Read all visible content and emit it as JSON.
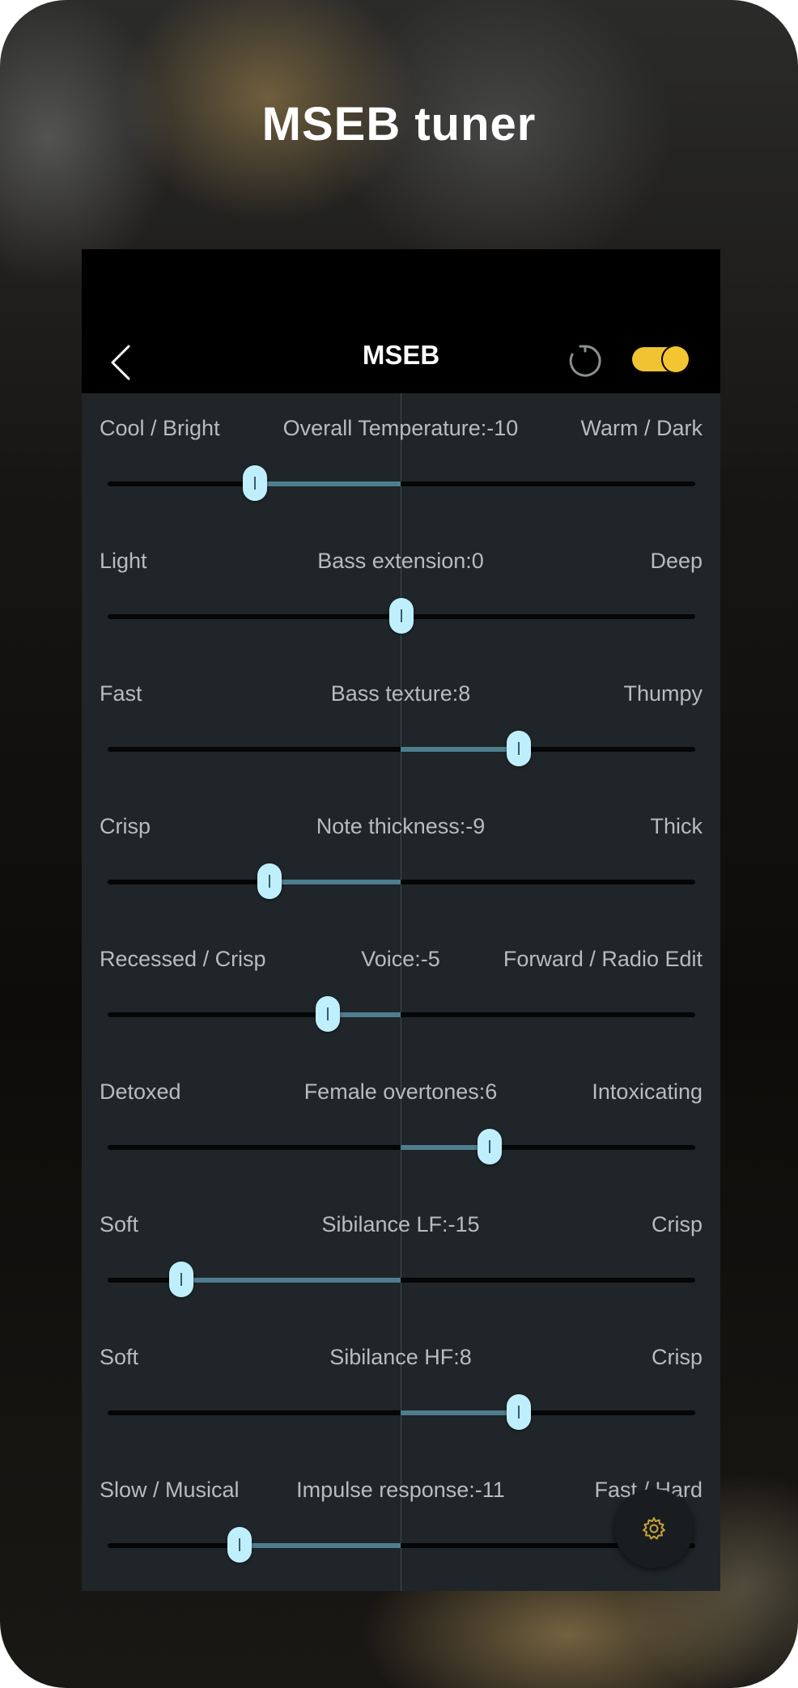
{
  "promo": {
    "title": "MSEB tuner"
  },
  "header": {
    "title": "MSEB",
    "toggle_on": true
  },
  "colors": {
    "accent_yellow": "#f1c232",
    "slider_fill": "#4e7e8e",
    "thumb": "#bfeffd",
    "panel_bg": "#1f2528"
  },
  "icons": {
    "back": "chevron-left-icon",
    "reset": "reset-icon",
    "settings": "gear-icon"
  },
  "slider_range": {
    "min": -20,
    "max": 20
  },
  "sliders": [
    {
      "left": "Cool / Bright",
      "center": "Overall Temperature:-10",
      "right": "Warm / Dark",
      "value": -10
    },
    {
      "left": "Light",
      "center": "Bass extension:0",
      "right": "Deep",
      "value": 0
    },
    {
      "left": "Fast",
      "center": "Bass texture:8",
      "right": "Thumpy",
      "value": 8
    },
    {
      "left": "Crisp",
      "center": "Note thickness:-9",
      "right": "Thick",
      "value": -9
    },
    {
      "left": "Recessed / Crisp",
      "center": "Voice:-5",
      "right": "Forward / Radio Edit",
      "value": -5
    },
    {
      "left": "Detoxed",
      "center": "Female overtones:6",
      "right": "Intoxicating",
      "value": 6
    },
    {
      "left": "Soft",
      "center": "Sibilance LF:-15",
      "right": "Crisp",
      "value": -15
    },
    {
      "left": "Soft",
      "center": "Sibilance HF:8",
      "right": "Crisp",
      "value": 8
    },
    {
      "left": "Slow / Musical",
      "center": "Impulse response:-11",
      "right": "Fast / Hard",
      "value": -11
    }
  ]
}
